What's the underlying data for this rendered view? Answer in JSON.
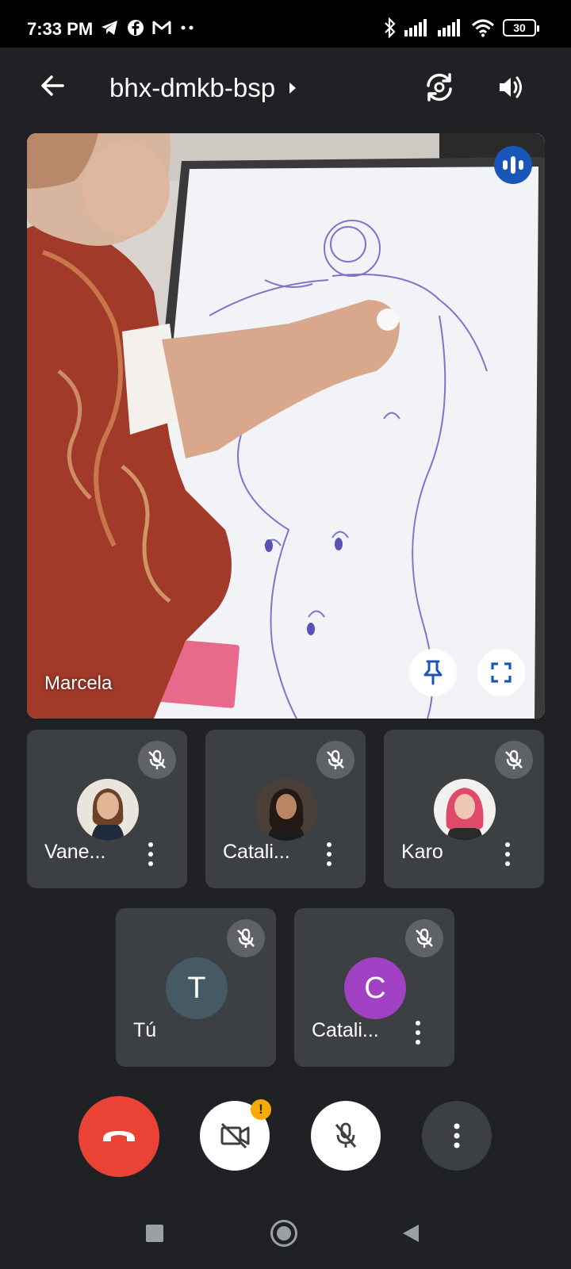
{
  "status_bar": {
    "time": "7:33 PM",
    "battery": "30",
    "left_icons": [
      "telegram-icon",
      "facebook-icon",
      "gmail-icon",
      "more-notifications-icon"
    ],
    "right_icons": [
      "bluetooth-icon",
      "signal-icon",
      "signal-icon",
      "wifi-icon",
      "battery-icon"
    ]
  },
  "header": {
    "meeting_code": "bhx-dmkb-bsp",
    "back_icon": "arrow-back-icon",
    "flip_icon": "switch-camera-icon",
    "audio_icon": "speaker-icon"
  },
  "main_speaker": {
    "name": "Marcela",
    "speaking_icon": "speaking-indicator-icon",
    "pin_icon": "pin-icon",
    "fullscreen_icon": "fullscreen-icon"
  },
  "participants": [
    {
      "name": "Vane...",
      "muted": true,
      "avatar_type": "photo"
    },
    {
      "name": "Catali...",
      "muted": true,
      "avatar_type": "photo"
    },
    {
      "name": "Karo",
      "muted": true,
      "avatar_type": "photo"
    },
    {
      "name": "Tú",
      "muted": true,
      "avatar_type": "letter",
      "letter": "T",
      "color": "#455a64"
    },
    {
      "name": "Catali...",
      "muted": true,
      "avatar_type": "letter",
      "letter": "C",
      "color": "#a142c4"
    }
  ],
  "controls": {
    "end_call_color": "#ea4335",
    "camera_warning": "!",
    "items": [
      "end-call-icon",
      "camera-off-icon",
      "mic-off-icon",
      "more-options-icon"
    ]
  },
  "nav": [
    "recents-icon",
    "home-icon",
    "back-icon"
  ]
}
